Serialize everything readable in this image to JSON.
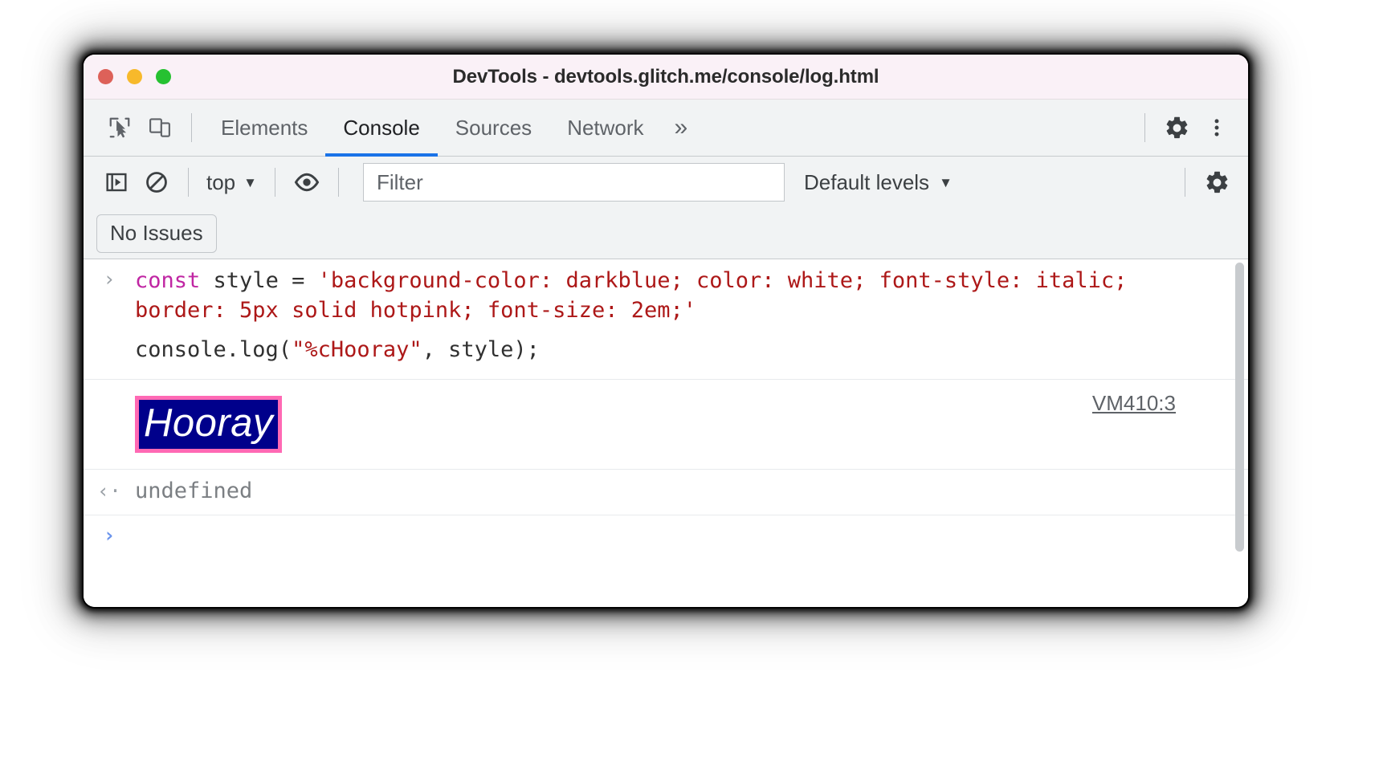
{
  "window": {
    "title": "DevTools - devtools.glitch.me/console/log.html",
    "traffic_lights": [
      {
        "name": "close",
        "color": "#dd6159"
      },
      {
        "name": "minimize",
        "color": "#f7b92b"
      },
      {
        "name": "maximize",
        "color": "#26c131"
      }
    ]
  },
  "tabbar": {
    "inspect_icon": "inspect-element-icon",
    "device_icon": "device-toolbar-icon",
    "tabs": [
      {
        "label": "Elements",
        "active": false
      },
      {
        "label": "Console",
        "active": true
      },
      {
        "label": "Sources",
        "active": false
      },
      {
        "label": "Network",
        "active": false
      }
    ],
    "more_label": "»",
    "settings_icon": "gear-icon",
    "menu_icon": "kebab-menu-icon",
    "active_tab_underline_color": "#1a73e8"
  },
  "console_toolbar": {
    "sidebar_icon": "console-sidebar-icon",
    "clear_icon": "clear-console-icon",
    "context_label": "top",
    "context_caret": "▼",
    "eye_icon": "live-expression-eye-icon",
    "filter_placeholder": "Filter",
    "filter_value": "",
    "levels_label": "Default levels",
    "levels_caret": "▼",
    "settings_icon": "console-settings-gear-icon"
  },
  "issues": {
    "label": "No Issues"
  },
  "console": {
    "entries": [
      {
        "type": "input",
        "arrow": "›",
        "segments": [
          {
            "text": "const ",
            "token": "keyword"
          },
          {
            "text": "style = ",
            "token": "default"
          },
          {
            "text": "'background-color: darkblue; color: white; font-style: italic; border: 5px solid hotpink; font-size: 2em;'",
            "token": "string"
          }
        ]
      },
      {
        "type": "input-continued",
        "arrow": "",
        "segments": [
          {
            "text": "console.log(",
            "token": "default"
          },
          {
            "text": "\"%cHooray\"",
            "token": "string"
          },
          {
            "text": ", style);",
            "token": "default"
          }
        ]
      },
      {
        "type": "styled-output",
        "text": "Hooray",
        "style": {
          "background_color": "#00008b",
          "color": "#ffffff",
          "font_style": "italic",
          "border": "5px solid #ff69b4",
          "font_size": "2em"
        },
        "source": "VM410:3"
      },
      {
        "type": "result",
        "arrow": "‹·",
        "text": "undefined"
      },
      {
        "type": "prompt",
        "arrow": "›",
        "text": ""
      }
    ]
  }
}
